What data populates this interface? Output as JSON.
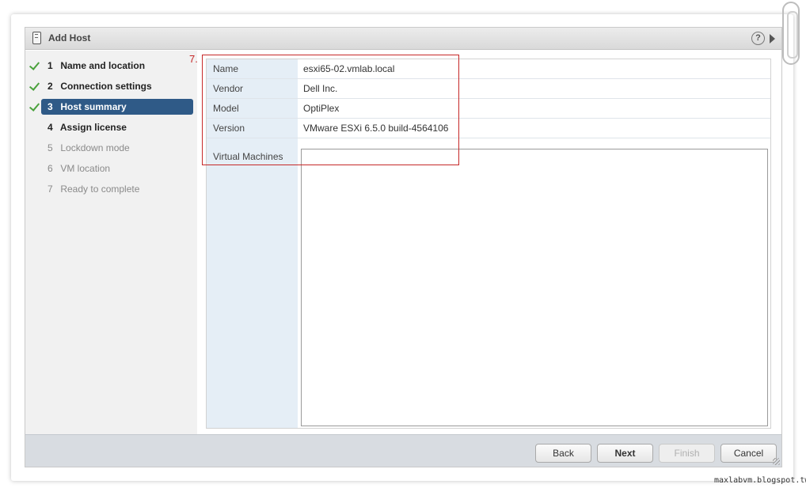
{
  "window": {
    "title": "Add Host",
    "help_symbol": "?"
  },
  "steps": [
    {
      "num": "1",
      "label": "Name and location",
      "state": "done"
    },
    {
      "num": "2",
      "label": "Connection settings",
      "state": "done"
    },
    {
      "num": "3",
      "label": "Host summary",
      "state": "active"
    },
    {
      "num": "4",
      "label": "Assign license",
      "state": "next"
    },
    {
      "num": "5",
      "label": "Lockdown mode",
      "state": "pending"
    },
    {
      "num": "6",
      "label": "VM location",
      "state": "pending"
    },
    {
      "num": "7",
      "label": "Ready to complete",
      "state": "pending"
    }
  ],
  "summary": {
    "rows": [
      {
        "label": "Name",
        "value": "esxi65-02.vmlab.local"
      },
      {
        "label": "Vendor",
        "value": "Dell Inc."
      },
      {
        "label": "Model",
        "value": "OptiPlex"
      },
      {
        "label": "Version",
        "value": "VMware ESXi 6.5.0 build-4564106"
      }
    ],
    "vm_label": "Virtual Machines"
  },
  "annotation": {
    "number": "7."
  },
  "buttons": {
    "back": "Back",
    "next": "Next",
    "finish": "Finish",
    "cancel": "Cancel"
  },
  "watermark": "maxlabvm.blogspot.tw",
  "colors": {
    "active_step": "#2f5a87",
    "check": "#4aa13c",
    "annotation": "#c62828"
  }
}
